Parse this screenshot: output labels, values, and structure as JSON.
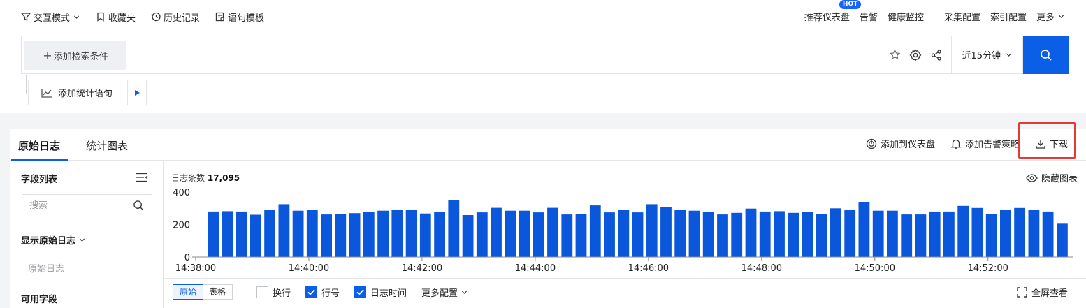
{
  "nav": {
    "left": [
      {
        "label": "交互模式",
        "icon": "filter-icon",
        "dropdown": true
      },
      {
        "label": "收藏夹",
        "icon": "bookmark-icon"
      },
      {
        "label": "历史记录",
        "icon": "history-icon"
      },
      {
        "label": "语句模板",
        "icon": "template-icon"
      }
    ],
    "right": {
      "recommended": "推荐仪表盘",
      "hot_badge": "HOT",
      "alarm": "告警",
      "health": "健康监控",
      "collect": "采集配置",
      "index": "索引配置",
      "more": "更多"
    }
  },
  "search": {
    "add_condition": "添加检索条件",
    "time_range": "近15分钟",
    "add_statistics": "添加统计语句"
  },
  "tabs": {
    "raw_logs": "原始日志",
    "stat_charts": "统计图表"
  },
  "actions": {
    "add_dashboard": "添加到仪表盘",
    "add_alarm": "添加告警策略",
    "download": "下载"
  },
  "sidebar": {
    "title": "字段列表",
    "search_placeholder": "搜索",
    "show_raw": "显示原始日志",
    "raw_field": "原始日志",
    "available_fields": "可用字段"
  },
  "chart": {
    "count_label": "日志条数",
    "count_value": "17,095",
    "hide_label": "隐藏图表"
  },
  "chart_data": {
    "type": "bar",
    "color": "#0b57dc",
    "ylim": [
      0,
      400
    ],
    "yticks": [
      0,
      200,
      400
    ],
    "xticks": [
      "14:38:00",
      "14:40:00",
      "14:42:00",
      "14:44:00",
      "14:46:00",
      "14:48:00",
      "14:50:00",
      "14:52:00"
    ],
    "values": [
      280,
      282,
      280,
      260,
      292,
      325,
      285,
      292,
      262,
      265,
      270,
      278,
      285,
      290,
      288,
      268,
      278,
      352,
      258,
      275,
      303,
      285,
      285,
      275,
      303,
      262,
      265,
      318,
      275,
      290,
      275,
      325,
      308,
      290,
      285,
      278,
      262,
      272,
      298,
      280,
      282,
      272,
      278,
      265,
      300,
      290,
      340,
      285,
      285,
      262,
      262,
      280,
      280,
      315,
      302,
      265,
      292,
      302,
      290,
      280,
      205
    ]
  },
  "bottom": {
    "seg_raw": "原始",
    "seg_table": "表格",
    "wrap": "换行",
    "line_no": "行号",
    "log_time": "日志时间",
    "more_config": "更多配置",
    "fullscreen": "全屏查看"
  }
}
